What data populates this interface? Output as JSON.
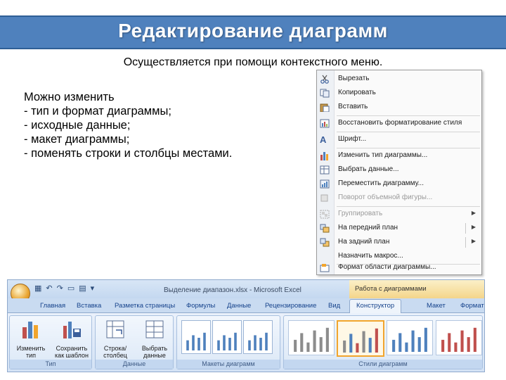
{
  "slide": {
    "title": "Редактирование диаграмм",
    "subtitle": "Осуществляется при помощи контекстного меню.",
    "body_lines": [
      "Можно изменить",
      "- тип и формат диаграммы;",
      "- исходные данные;",
      "- макет диаграммы;",
      "- поменять строки и столбцы местами."
    ]
  },
  "context_menu": {
    "items": [
      {
        "label": "Вырезать",
        "icon": "scissors-icon",
        "disabled": false
      },
      {
        "label": "Копировать",
        "icon": "copy-icon",
        "disabled": false
      },
      {
        "label": "Вставить",
        "icon": "paste-icon",
        "disabled": false
      },
      {
        "label": "Восстановить форматирование стиля",
        "icon": "reset-style-icon",
        "disabled": false
      },
      {
        "label": "Шрифт...",
        "icon": "font-icon",
        "disabled": false
      },
      {
        "label": "Изменить тип диаграммы...",
        "icon": "chart-type-icon",
        "disabled": false
      },
      {
        "label": "Выбрать данные...",
        "icon": "select-data-icon",
        "disabled": false
      },
      {
        "label": "Переместить диаграмму...",
        "icon": "move-chart-icon",
        "disabled": false
      },
      {
        "label": "Поворот объемной фигуры...",
        "icon": "rotate-3d-icon",
        "disabled": true
      },
      {
        "label": "Группировать",
        "icon": "group-icon",
        "disabled": true
      },
      {
        "label": "На передний план",
        "icon": "bring-front-icon",
        "disabled": false
      },
      {
        "label": "На задний план",
        "icon": "send-back-icon",
        "disabled": false
      },
      {
        "label": "Назначить макрос...",
        "icon": "macro-icon",
        "disabled": false
      },
      {
        "label": "Формат области диаграммы...",
        "icon": "format-area-icon",
        "disabled": false
      }
    ]
  },
  "ribbon": {
    "window_title": "Выделение диапазон.xlsx - Microsoft Excel",
    "context_tab_group": "Работа с диаграммами",
    "tabs": [
      "Главная",
      "Вставка",
      "Разметка страницы",
      "Формулы",
      "Данные",
      "Рецензирование",
      "Вид",
      "Конструктор",
      "Макет",
      "Формат"
    ],
    "active_tab": "Конструктор",
    "groups": {
      "type_label": "Тип",
      "data_label": "Данные",
      "layouts_label": "Макеты диаграмм",
      "styles_label": "Стили диаграмм"
    },
    "buttons": {
      "change_type": "Изменить тип диаграммы",
      "save_template": "Сохранить как шаблон",
      "switch_row_col": "Строка/столбец",
      "select_data": "Выбрать данные"
    },
    "colors": {
      "accent": "#4f81bd",
      "gray": "#8c8c8c",
      "blue": "#4f81bd",
      "red": "#c0504d"
    }
  }
}
